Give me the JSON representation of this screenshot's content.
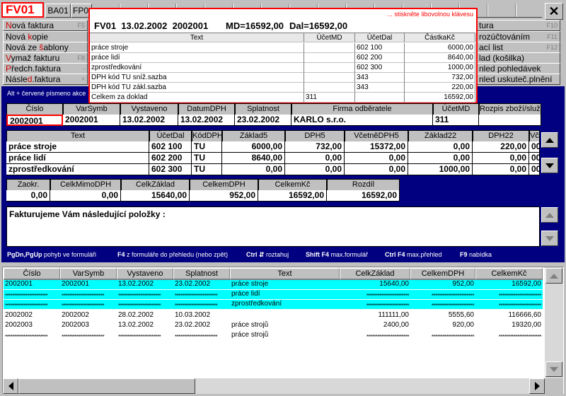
{
  "window": {
    "doc_code": "FV01",
    "tabs": [
      "BA01",
      "FP0"
    ],
    "close_glyph": "✕"
  },
  "left_menu": [
    {
      "label_pre": "",
      "label_key": "N",
      "label_post": "ová faktura",
      "shortcut": "F5"
    },
    {
      "label_pre": "Nová ",
      "label_key": "k",
      "label_post": "opie",
      "shortcut": ""
    },
    {
      "label_pre": "Nová ze ",
      "label_key": "š",
      "label_post": "ablony",
      "shortcut": ""
    },
    {
      "label_pre": "",
      "label_key": "V",
      "label_post": "ymaž fakturu",
      "shortcut": "F8"
    },
    {
      "label_pre": "",
      "label_key": "P",
      "label_post": "ředch.faktura",
      "shortcut": "-"
    },
    {
      "label_pre": "Násle",
      "label_key": "d",
      "label_post": ".faktura",
      "shortcut": "+"
    }
  ],
  "right_menu": [
    {
      "label": "tura",
      "shortcut": "F10"
    },
    {
      "label": "rozúčtováním",
      "shortcut": "F11"
    },
    {
      "label": "ací list",
      "shortcut": "F12"
    },
    {
      "label": "lad (košilka)",
      "shortcut": ""
    },
    {
      "label": "nled pohledávek",
      "shortcut": ""
    },
    {
      "label": "nled uskuteč.plnění",
      "shortcut": ""
    }
  ],
  "alt_hint": "Alt + červené písmeno akce",
  "popup": {
    "hint": "... stiskněte libovolnou klávesu",
    "title": "FV01  13.02.2002  2002001",
    "md": "MD=16592,00",
    "dal": "Dal=16592,00",
    "headers": [
      "Text",
      "ÚčetMD",
      "ÚčetDal",
      "ČástkaKč"
    ],
    "rows": [
      [
        "práce stroje",
        "",
        "602 100",
        "6000,00"
      ],
      [
        "práce lidí",
        "",
        "602 200",
        "8640,00"
      ],
      [
        "zprostředkování",
        "",
        "602 300",
        "1000,00"
      ],
      [
        "DPH kód TU sníž.sazba",
        "",
        "343",
        "732,00"
      ],
      [
        "DPH kód TU zákl.sazba",
        "",
        "343",
        "220,00"
      ],
      [
        "Celkem za doklad",
        "311",
        "",
        "16592,00"
      ]
    ]
  },
  "invoice_header": {
    "headers": [
      "Číslo",
      "VarSymb",
      "Vystaveno",
      "DatumDPH",
      "Splatnost",
      "Firma odběratele",
      "ÚčetMD",
      "Rozpis zboží/služeb"
    ],
    "values": [
      "2002001",
      "2002001",
      "13.02.2002",
      "13.02.2002",
      "23.02.2002",
      "KARLO s.r.o.",
      "311",
      ""
    ]
  },
  "items": {
    "headers": [
      "Text",
      "ÚčetDal",
      "KódDPH",
      "Základ5",
      "DPH5",
      "VčetněDPH5",
      "Základ22",
      "DPH22",
      "Vč"
    ],
    "rows": [
      [
        "práce stroje",
        "602 100",
        "TU",
        "6000,00",
        "732,00",
        "15372,00",
        "0,00",
        "220,00",
        "00"
      ],
      [
        "práce lidí",
        "602 200",
        "TU",
        "8640,00",
        "0,00",
        "0,00",
        "0,00",
        "0,00",
        "00"
      ],
      [
        "zprostředkování",
        "602 300",
        "TU",
        "0,00",
        "0,00",
        "0,00",
        "1000,00",
        "0,00",
        "00"
      ]
    ]
  },
  "totals": {
    "headers": [
      "Zaokr.",
      "CelkMimoDPH",
      "CelkZáklad",
      "CelkemDPH",
      "CelkemKč",
      "Rozdíl"
    ],
    "values": [
      "0,00",
      "0,00",
      "15640,00",
      "952,00",
      "16592,00",
      "16592,00"
    ]
  },
  "note_text": "Fakturujeme Vám následující položky :",
  "hints": [
    {
      "key": "PgDn,PgUp",
      "text": " pohyb ve formuláři"
    },
    {
      "key": "F4",
      "text": " z formuláře do přehledu (nebo zpět)"
    },
    {
      "key": "Ctrl ⇵",
      "text": " roztahuj"
    },
    {
      "key": "Shift F4",
      "text": " max.formulář"
    },
    {
      "key": "Ctrl F4",
      "text": " max.přehled"
    },
    {
      "key": "F9",
      "text": " nabídka"
    }
  ],
  "list": {
    "headers": [
      "Číslo",
      "VarSymb",
      "Vystaveno",
      "Splatnost",
      "Text",
      "CelkZáklad",
      "CelkemDPH",
      "CelkemKč"
    ],
    "rows": [
      {
        "style": "cyan",
        "cells": [
          "2002001",
          "2002001",
          "13.02.2002",
          "23.02.2002",
          "práce stroje",
          "15640,00",
          "952,00",
          "16592,00"
        ]
      },
      {
        "style": "cyan-stars",
        "cells": [
          "***********************",
          "***********************",
          "***********************",
          "***********************",
          "práce lidí",
          "***********************",
          "***********************",
          "***********************"
        ]
      },
      {
        "style": "cyan-stars",
        "cells": [
          "***********************",
          "***********************",
          "***********************",
          "***********************",
          "zprostředkování",
          "***********************",
          "***********************",
          "***********************"
        ]
      },
      {
        "style": "white",
        "cells": [
          "2002002",
          "2002002",
          "28.02.2002",
          "10.03.2002",
          "",
          "111111,00",
          "5555,60",
          "116666,60"
        ]
      },
      {
        "style": "white",
        "cells": [
          "2002003",
          "2002003",
          "13.02.2002",
          "23.02.2002",
          "práce strojů",
          "2400,00",
          "920,00",
          "19320,00"
        ]
      },
      {
        "style": "white-stars",
        "cells": [
          "***********************",
          "***********************",
          "***********************",
          "***********************",
          "práce strojů",
          "***********************",
          "***********************",
          "***********************"
        ]
      }
    ]
  },
  "colors": {
    "navy": "#000080",
    "cyan": "#00ffff",
    "red": "#ff0000",
    "accent_red": "#d00000"
  }
}
